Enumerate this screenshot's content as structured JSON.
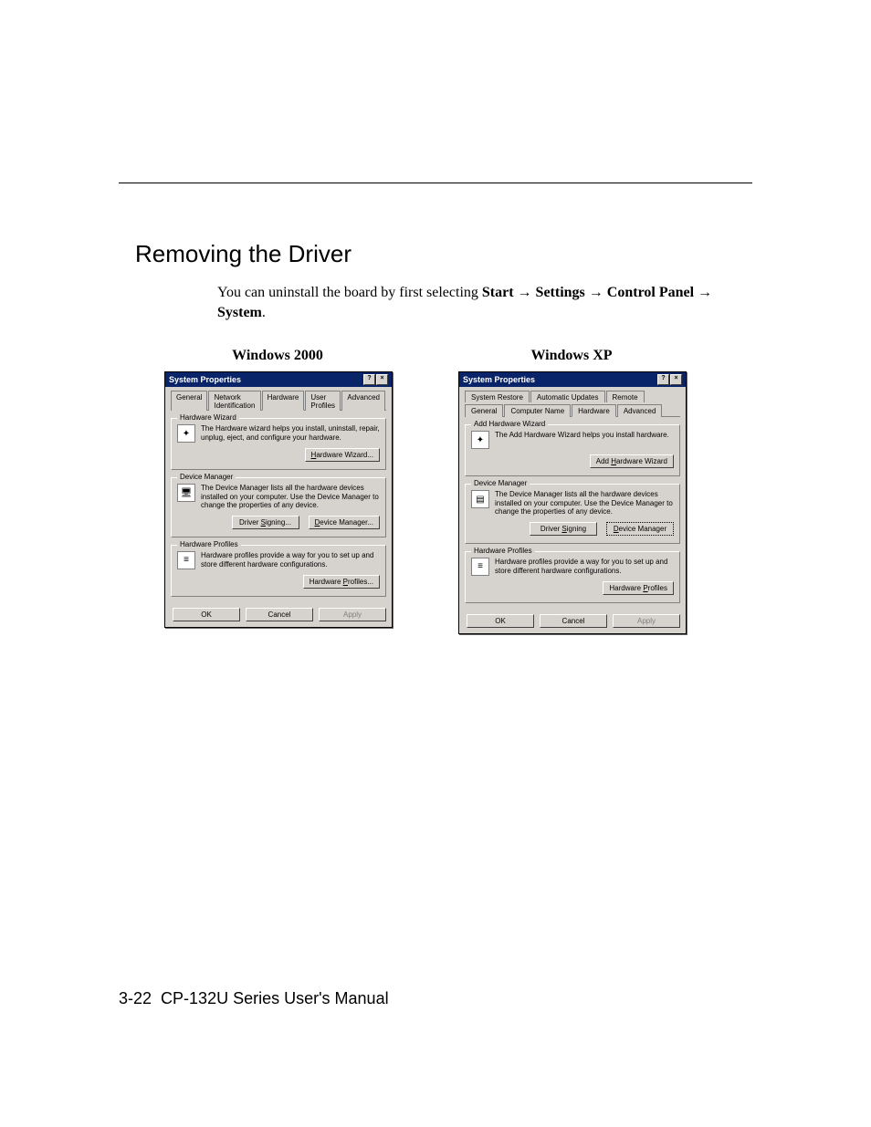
{
  "header_rule": true,
  "section_title": "Removing the Driver",
  "intro_prefix": "You can uninstall the board by first selecting ",
  "path_parts": [
    "Start",
    "Settings",
    "Control Panel",
    "System"
  ],
  "arrow": "→",
  "period": ".",
  "columns": {
    "left_title": "Windows 2000",
    "right_title": "Windows XP"
  },
  "win2000": {
    "title": "System Properties",
    "help": "?",
    "close": "×",
    "tabs": [
      "General",
      "Network Identification",
      "Hardware",
      "User Profiles",
      "Advanced"
    ],
    "active_tab": "Hardware",
    "hw_wizard": {
      "title": "Hardware Wizard",
      "desc": "The Hardware wizard helps you install, uninstall, repair, unplug, eject, and configure your hardware.",
      "button": "Hardware Wizard..."
    },
    "dev_mgr": {
      "title": "Device Manager",
      "desc": "The Device Manager lists all the hardware devices installed on your computer. Use the Device Manager to change the properties of any device.",
      "btn1": "Driver Signing...",
      "btn2": "Device Manager..."
    },
    "hw_profiles": {
      "title": "Hardware Profiles",
      "desc": "Hardware profiles provide a way for you to set up and store different hardware configurations.",
      "button": "Hardware Profiles..."
    },
    "ok": "OK",
    "cancel": "Cancel",
    "apply": "Apply"
  },
  "winxp": {
    "title": "System Properties",
    "help": "?",
    "close": "×",
    "tabs_row1": [
      "System Restore",
      "Automatic Updates",
      "Remote"
    ],
    "tabs_row2": [
      "General",
      "Computer Name",
      "Hardware",
      "Advanced"
    ],
    "active_tab": "Hardware",
    "add_hw": {
      "title": "Add Hardware Wizard",
      "desc": "The Add Hardware Wizard helps you install hardware.",
      "button": "Add Hardware Wizard"
    },
    "dev_mgr": {
      "title": "Device Manager",
      "desc": "The Device Manager lists all the hardware devices installed on your computer. Use the Device Manager to change the properties of any device.",
      "btn1": "Driver Signing",
      "btn2": "Device Manager"
    },
    "hw_profiles": {
      "title": "Hardware Profiles",
      "desc": "Hardware profiles provide a way for you to set up and store different hardware configurations.",
      "button": "Hardware Profiles"
    },
    "ok": "OK",
    "cancel": "Cancel",
    "apply": "Apply"
  },
  "footer": {
    "page": "3-22",
    "manual": "CP-132U Series User's Manual"
  },
  "icons": {
    "wizard": "wizard-icon",
    "monitor": "monitor-icon",
    "chip": "chip-icon",
    "profile": "profile-icon"
  }
}
